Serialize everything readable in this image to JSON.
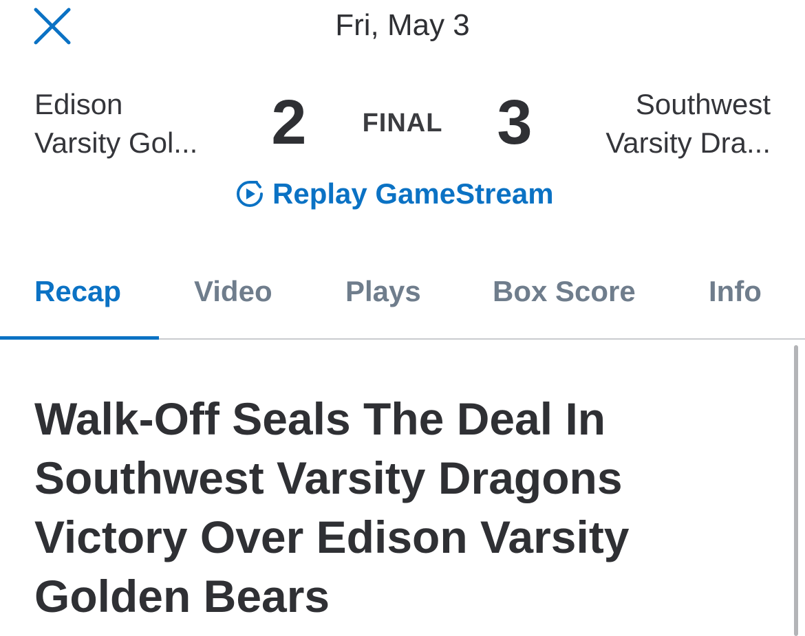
{
  "header": {
    "close_icon": "close-icon",
    "date": "Fri, May 3"
  },
  "game": {
    "home_team_line1": "Edison",
    "home_team_line2": "Varsity Gol...",
    "home_score": "2",
    "status": "FINAL",
    "away_score": "3",
    "away_team_line1": "Southwest",
    "away_team_line2": "Varsity Dra...",
    "replay_label": "Replay GameStream",
    "replay_icon": "replay-play-icon"
  },
  "tabs": [
    {
      "label": "Recap",
      "active": true
    },
    {
      "label": "Video",
      "active": false
    },
    {
      "label": "Plays",
      "active": false
    },
    {
      "label": "Box Score",
      "active": false
    },
    {
      "label": "Info",
      "active": false
    }
  ],
  "article": {
    "headline": "Walk-Off Seals The Deal In Southwest Varsity Dragons Victory Over Edison Varsity Golden Bears"
  },
  "colors": {
    "accent": "#0b72c4",
    "text": "#2f3034",
    "tab_inactive": "#6f7d8c"
  }
}
